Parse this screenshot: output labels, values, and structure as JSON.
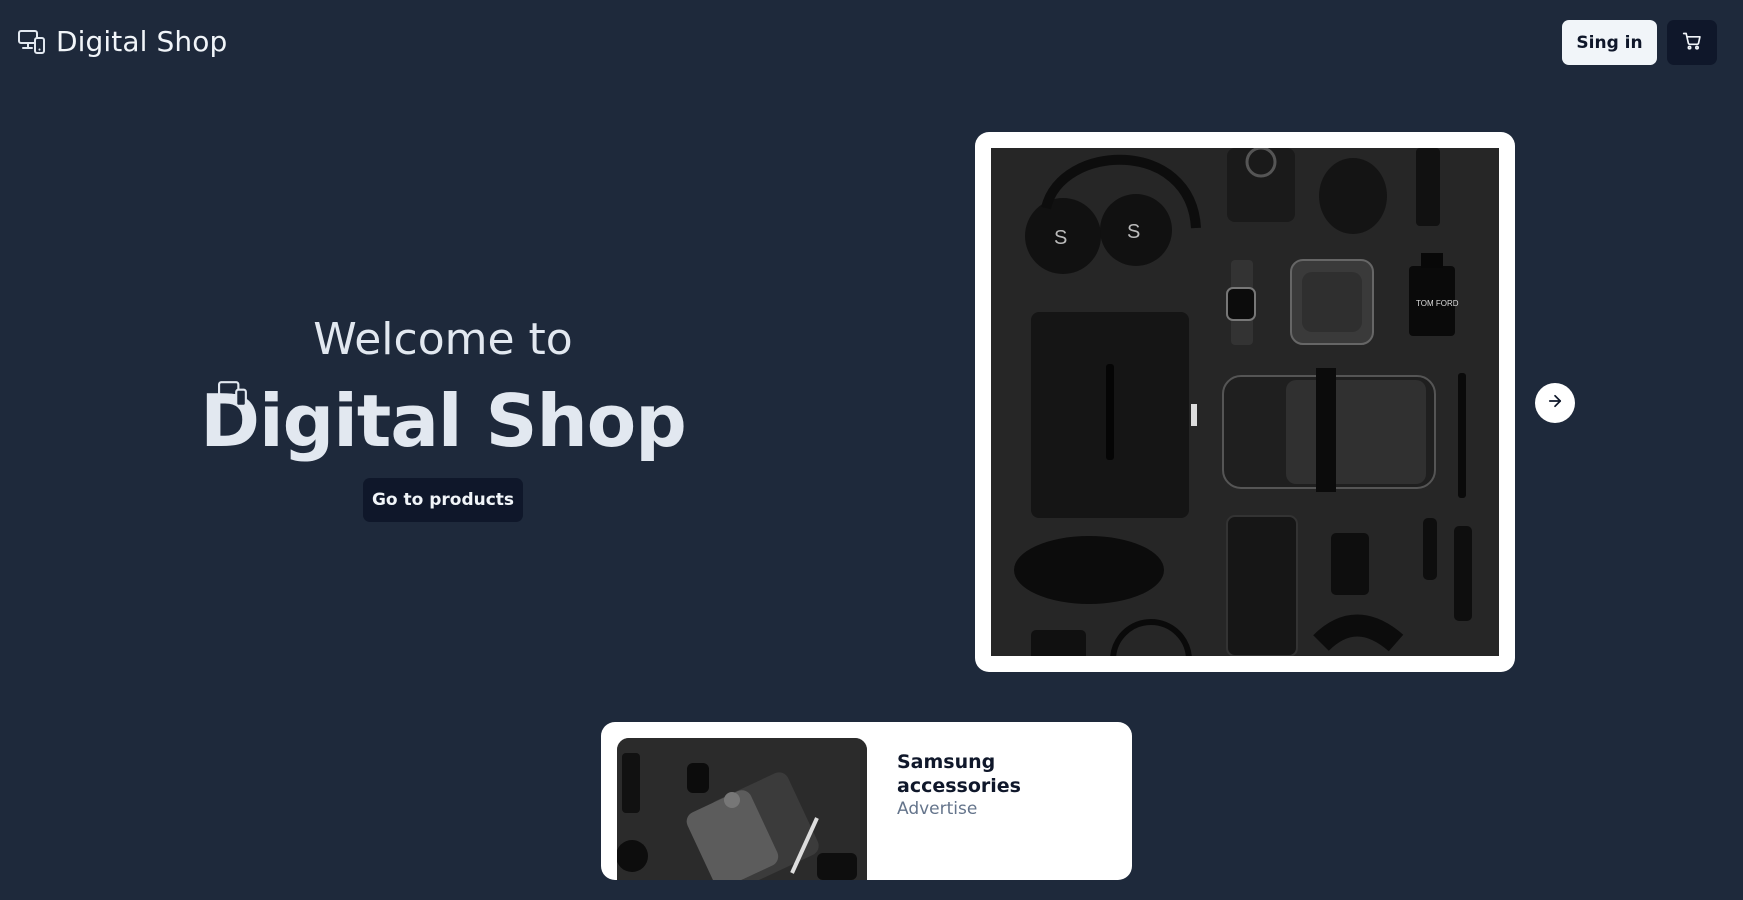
{
  "header": {
    "brand_name": "Digital Shop",
    "brand_icon": "devices-icon",
    "signin_label": "Sing in",
    "cart_icon": "cart-icon"
  },
  "hero": {
    "welcome_text": "Welcome to",
    "title": "Digital Shop",
    "cta_label": "Go to products"
  },
  "carousel": {
    "image_alt": "flat lay of black tech accessories",
    "next_icon": "arrow-right-icon"
  },
  "products": [
    {
      "title": "Samsung accessories",
      "subtitle": "Advertise"
    }
  ],
  "colors": {
    "background": "#1e293b",
    "button_dark": "#0f172a",
    "button_light": "#f1f5f9",
    "muted_text": "#64748b"
  }
}
